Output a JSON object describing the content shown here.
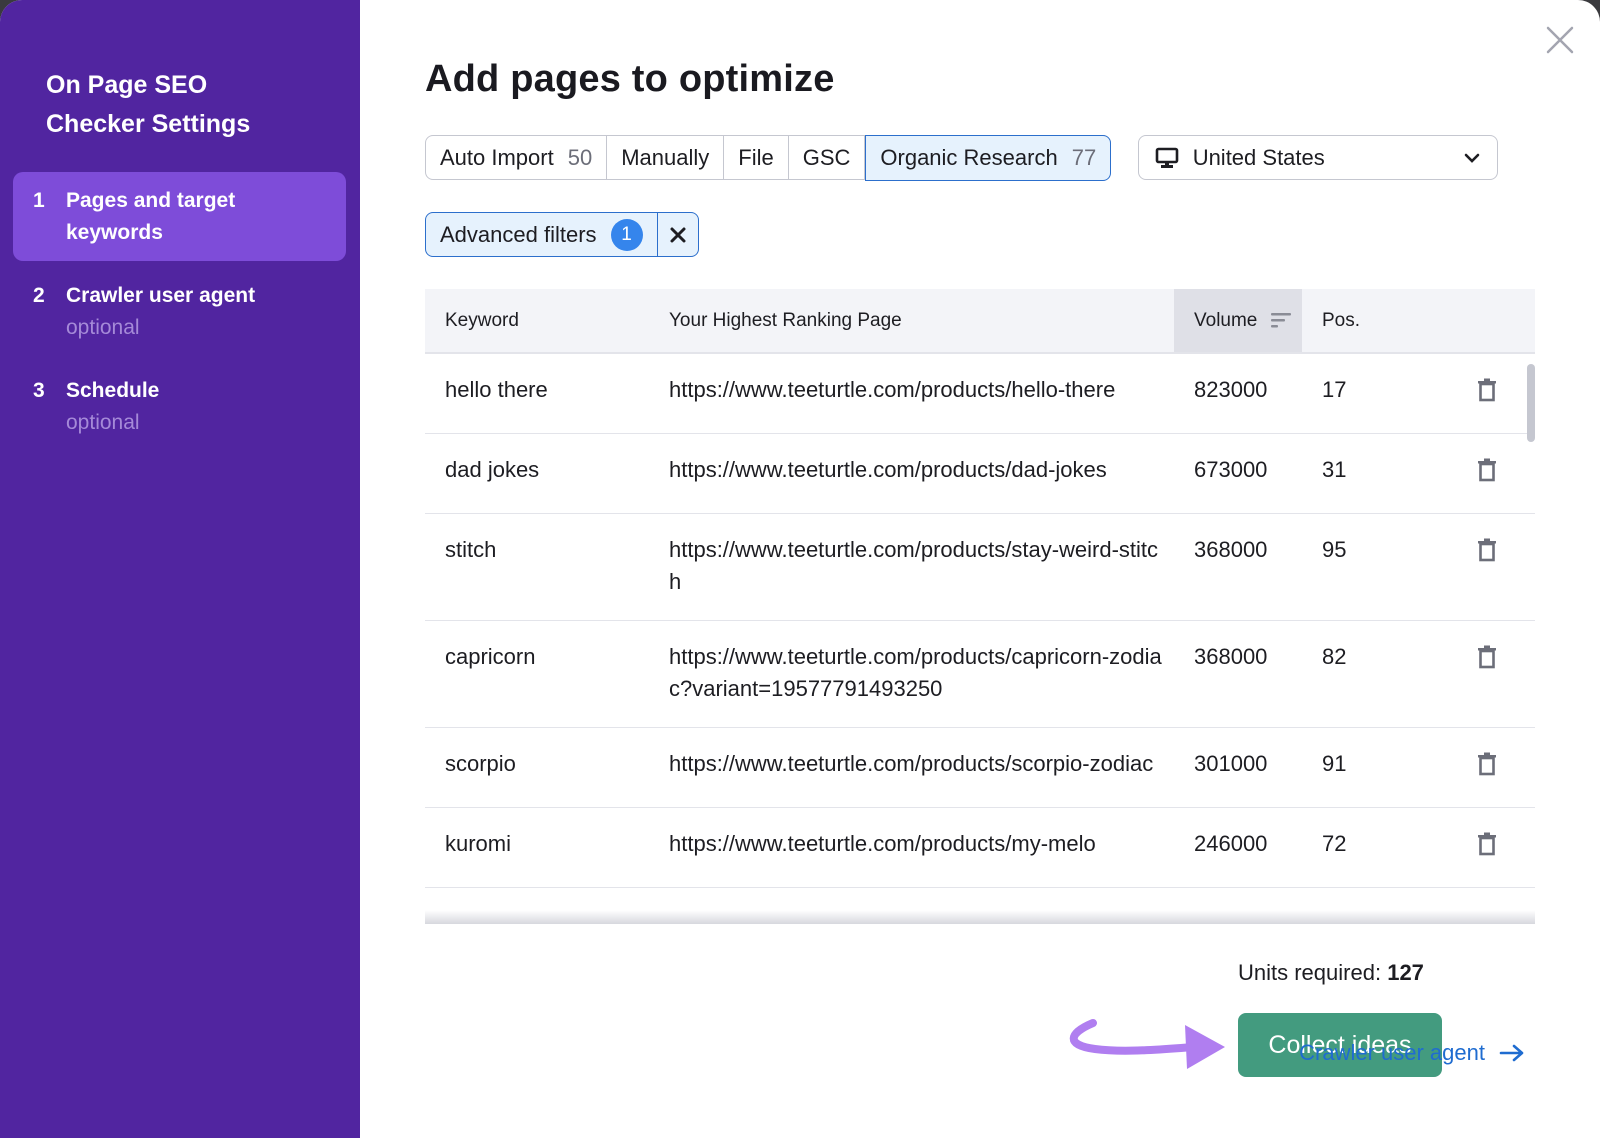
{
  "sidebar": {
    "title_line1": "On Page SEO",
    "title_line2": "Checker Settings",
    "steps": [
      {
        "number": "1",
        "label_line1": "Pages and target",
        "label_line2": "keywords",
        "sub": "",
        "active": true
      },
      {
        "number": "2",
        "label_line1": "Crawler user agent",
        "label_line2": "",
        "sub": "optional",
        "active": false
      },
      {
        "number": "3",
        "label_line1": "Schedule",
        "label_line2": "",
        "sub": "optional",
        "active": false
      }
    ]
  },
  "main": {
    "title": "Add pages to optimize",
    "tabs": [
      {
        "label": "Auto Import",
        "count": "50"
      },
      {
        "label": "Manually",
        "count": ""
      },
      {
        "label": "File",
        "count": ""
      },
      {
        "label": "GSC",
        "count": ""
      },
      {
        "label": "Organic Research",
        "count": "77",
        "active": true
      }
    ],
    "country": {
      "icon": "desktop-icon",
      "label": "United States"
    },
    "filters": {
      "label": "Advanced filters",
      "count": "1"
    },
    "table": {
      "columns": [
        "Keyword",
        "Your Highest Ranking Page",
        "Volume",
        "Pos."
      ],
      "sorted_column": "Volume",
      "rows": [
        {
          "keyword": "hello there",
          "url": "https://www.teeturtle.com/products/hello-there",
          "volume": "823000",
          "pos": "17"
        },
        {
          "keyword": "dad jokes",
          "url": "https://www.teeturtle.com/products/dad-jokes",
          "volume": "673000",
          "pos": "31"
        },
        {
          "keyword": "stitch",
          "url": "https://www.teeturtle.com/products/stay-weird-stitch",
          "volume": "368000",
          "pos": "95"
        },
        {
          "keyword": "capricorn",
          "url": "https://www.teeturtle.com/products/capricorn-zodiac?variant=19577791493250",
          "volume": "368000",
          "pos": "82"
        },
        {
          "keyword": "scorpio",
          "url": "https://www.teeturtle.com/products/scorpio-zodiac",
          "volume": "301000",
          "pos": "91"
        },
        {
          "keyword": "kuromi",
          "url": "https://www.teeturtle.com/products/my-melo",
          "volume": "246000",
          "pos": "72"
        }
      ]
    },
    "units_label": "Units required:",
    "units_value": "127",
    "collect_button": "Collect ideas",
    "next_link": "Crawler user agent"
  },
  "colors": {
    "sidebar_bg": "#5125a0",
    "sidebar_active": "#7e4cd9",
    "primary_button": "#439b7f",
    "link": "#1f6cd0",
    "accent_blue": "#2c6fcc",
    "annotation_arrow": "#b07ef0"
  }
}
